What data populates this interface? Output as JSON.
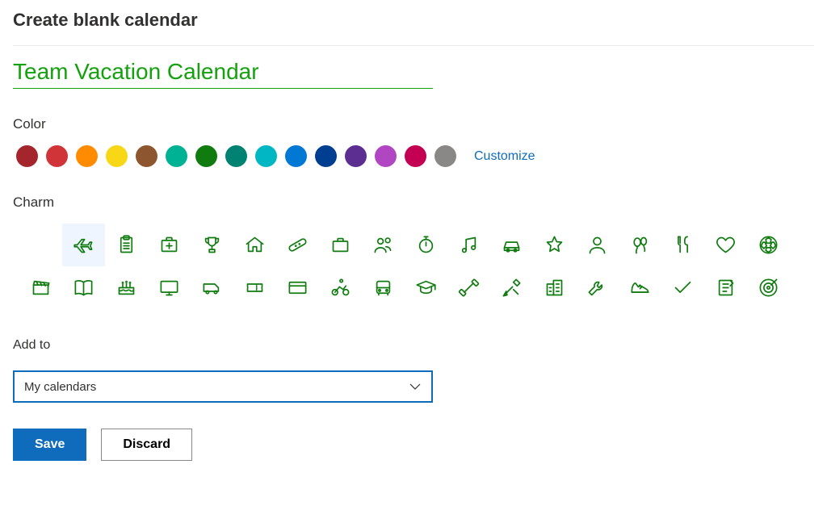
{
  "header": {
    "title": "Create blank calendar"
  },
  "calendar": {
    "name": "Team Vacation Calendar"
  },
  "colorSection": {
    "label": "Color",
    "customize": "Customize",
    "swatches": [
      "#a4262c",
      "#d13438",
      "#ff8c00",
      "#f7d716",
      "#8e562e",
      "#00b294",
      "#107c10",
      "#008272",
      "#00b7c3",
      "#0078d4",
      "#003e92",
      "#5c2e91",
      "#b146c2",
      "#c30052",
      "#8a8886"
    ]
  },
  "charmSection": {
    "label": "Charm",
    "selectedIndex": 1,
    "charms": [
      "none",
      "airplane",
      "clipboard",
      "first-aid",
      "trophy",
      "home",
      "bandage",
      "briefcase",
      "people",
      "stopwatch",
      "music",
      "car",
      "star",
      "person",
      "balloons",
      "utensils",
      "heart",
      "soccer",
      "clapper",
      "book",
      "cake",
      "monitor",
      "van",
      "ticket",
      "credit-card",
      "cyclist",
      "bus",
      "graduation",
      "dumbbell",
      "tools",
      "buildings",
      "wrench",
      "sneaker",
      "checkmark",
      "notebook",
      "target"
    ]
  },
  "addTo": {
    "label": "Add to",
    "value": "My calendars"
  },
  "buttons": {
    "save": "Save",
    "discard": "Discard"
  }
}
